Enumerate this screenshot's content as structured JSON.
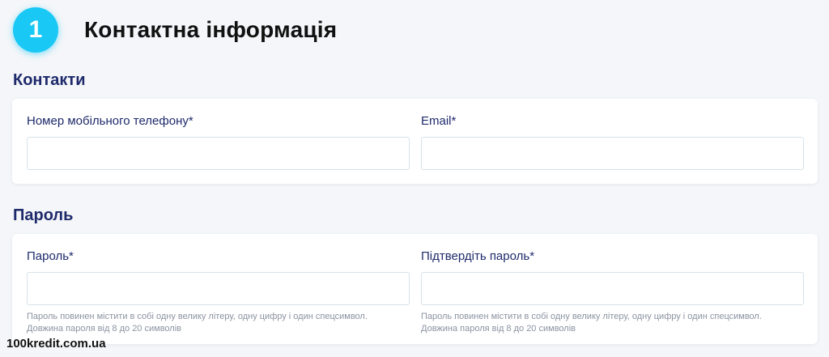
{
  "step": {
    "number": "1",
    "title": "Контактна інформація"
  },
  "contacts": {
    "title": "Контакти",
    "phone": {
      "label": "Номер мобільного телефону*",
      "value": "",
      "placeholder": ""
    },
    "email": {
      "label": "Email*",
      "value": "",
      "placeholder": ""
    }
  },
  "password_section": {
    "title": "Пароль",
    "password": {
      "label": "Пароль*",
      "value": "",
      "placeholder": "",
      "hint_line1": "Пароль повинен містити в собі одну велику літеру, одну цифру і один спецсимвол.",
      "hint_line2": "Довжина пароля від 8 до 20 символів"
    },
    "confirm": {
      "label": "Підтвердіть пароль*",
      "value": "",
      "placeholder": "",
      "hint_line1": "Пароль повинен містити в собі одну велику літеру, одну цифру і один спецсимвол.",
      "hint_line2": "Довжина пароля від 8 до 20 символів"
    }
  },
  "watermark": "100kredit.com.ua",
  "colors": {
    "accent": "#19c8f5",
    "heading": "#1e2a6b",
    "background": "#f4f6f9",
    "hint": "#8b93a1"
  }
}
